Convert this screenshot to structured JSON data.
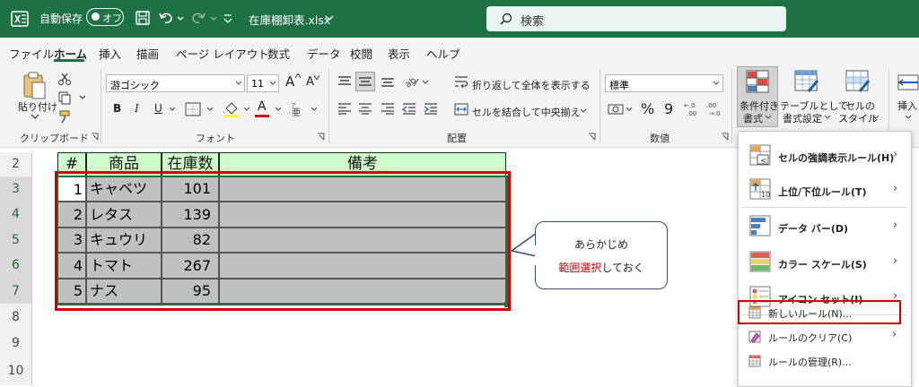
{
  "titlebar": {
    "autosave_label": "自動保存",
    "autosave_state": "オフ",
    "filename": "在庫棚卸表.xlsx",
    "search_placeholder": "検索"
  },
  "menu": {
    "tabs": [
      "ファイル",
      "ホーム",
      "挿入",
      "描画",
      "ページ レイアウト",
      "数式",
      "データ",
      "校閲",
      "表示",
      "ヘルプ"
    ],
    "active": "ホーム"
  },
  "ribbon": {
    "clipboard": {
      "paste": "貼り付け",
      "group": "クリップボード"
    },
    "font": {
      "name": "游ゴシック",
      "size": "11",
      "group": "フォント",
      "inc": "A",
      "dec": "A",
      "bold": "B",
      "italic": "I",
      "underline": "U",
      "fontcolor": "A"
    },
    "alignment": {
      "wrap": "折り返して全体を表示する",
      "merge": "セルを結合して中央揃え",
      "group": "配置"
    },
    "number": {
      "format": "標準",
      "group": "数値",
      "percent": "%",
      "comma": "9"
    },
    "styles": {
      "conditional_line1": "条件付き",
      "conditional_line2": "書式",
      "table_line1": "テーブルとして",
      "table_line2": "書式設定",
      "cell_line1": "セルの",
      "cell_line2": "スタイル"
    },
    "cells": {
      "insert": "挿入"
    }
  },
  "sheet": {
    "row_numbers": [
      "2",
      "3",
      "4",
      "5",
      "6",
      "7",
      "8",
      "9",
      "10"
    ],
    "headers": [
      "#",
      "商品",
      "在庫数",
      "備考"
    ],
    "rows": [
      {
        "num": "1",
        "item": "キャベツ",
        "qty": "101"
      },
      {
        "num": "2",
        "item": "レタス",
        "qty": "139"
      },
      {
        "num": "3",
        "item": "キュウリ",
        "qty": "82"
      },
      {
        "num": "4",
        "item": "トマト",
        "qty": "267"
      },
      {
        "num": "5",
        "item": "ナス",
        "qty": "95"
      }
    ]
  },
  "callout": {
    "line1": "あらかじめ",
    "line2_highlight": "範囲選択",
    "line2_rest": "しておく"
  },
  "dropdown": {
    "items": [
      {
        "label": "セルの強調表示ルール(H)",
        "bold": true,
        "submenu": true
      },
      {
        "label": "上位/下位ルール(T)",
        "bold": true,
        "submenu": true
      },
      {
        "label": "データ バー(D)",
        "bold": true,
        "submenu": true
      },
      {
        "label": "カラー スケール(S)",
        "bold": true,
        "submenu": true
      },
      {
        "label": "アイコン セット(I)",
        "bold": true,
        "submenu": true
      },
      {
        "label": "新しいルール(N)...",
        "bold": false,
        "submenu": false
      },
      {
        "label": "ルールのクリア(C)",
        "bold": false,
        "submenu": true
      },
      {
        "label": "ルールの管理(R)...",
        "bold": false,
        "submenu": false
      }
    ],
    "submenu_arrow": "›"
  },
  "colors": {
    "excel_green": "#1e7145",
    "header_fill": "#ccffcc",
    "selection_fill": "#c0c0c0",
    "highlight_red": "#d40000",
    "callout_border": "#2f4f74"
  }
}
